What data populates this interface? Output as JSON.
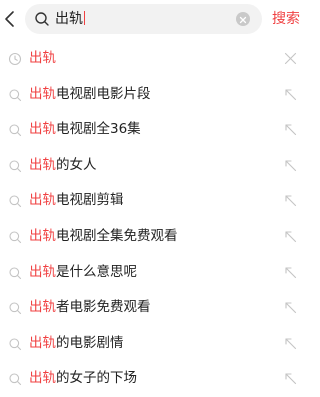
{
  "colors": {
    "accent": "#f04142",
    "text": "#222222",
    "icon": "#c4c4c4",
    "search_bg": "#f2f2f2"
  },
  "search": {
    "query": "出轨",
    "button_label": "搜索"
  },
  "history": [
    {
      "highlight": "出轨",
      "rest": "",
      "icon": "clock-icon",
      "action": "delete-icon"
    }
  ],
  "suggestions": [
    {
      "highlight": "出轨",
      "rest": "电视剧电影片段",
      "icon": "search-icon",
      "action": "fill-arrow-icon"
    },
    {
      "highlight": "出轨",
      "rest": "电视剧全36集",
      "icon": "search-icon",
      "action": "fill-arrow-icon"
    },
    {
      "highlight": "出轨",
      "rest": "的女人",
      "icon": "search-icon",
      "action": "fill-arrow-icon"
    },
    {
      "highlight": "出轨",
      "rest": "电视剧剪辑",
      "icon": "search-icon",
      "action": "fill-arrow-icon"
    },
    {
      "highlight": "出轨",
      "rest": "电视剧全集免费观看",
      "icon": "search-icon",
      "action": "fill-arrow-icon"
    },
    {
      "highlight": "出轨",
      "rest": "是什么意思呢",
      "icon": "search-icon",
      "action": "fill-arrow-icon"
    },
    {
      "highlight": "出轨",
      "rest": "者电影免费观看",
      "icon": "search-icon",
      "action": "fill-arrow-icon"
    },
    {
      "highlight": "出轨",
      "rest": "的电影剧情",
      "icon": "search-icon",
      "action": "fill-arrow-icon"
    },
    {
      "highlight": "出轨",
      "rest": "的女子的下场",
      "icon": "search-icon",
      "action": "fill-arrow-icon"
    }
  ]
}
